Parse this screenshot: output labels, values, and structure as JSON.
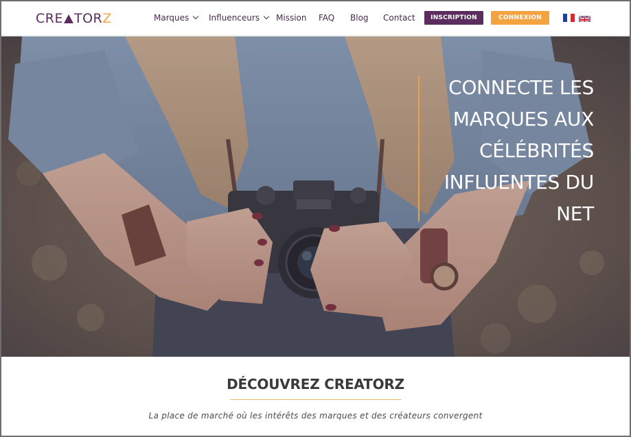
{
  "header": {
    "logo_prefix": "CRE",
    "logo_middle": "TOR",
    "logo_suffix": "Z",
    "nav": [
      {
        "label": "Marques",
        "has_dropdown": true
      },
      {
        "label": "Influenceurs",
        "has_dropdown": true
      },
      {
        "label": "Mission",
        "has_dropdown": false
      },
      {
        "label": "FAQ",
        "has_dropdown": false
      },
      {
        "label": "Blog",
        "has_dropdown": false
      },
      {
        "label": "Contact",
        "has_dropdown": false
      }
    ],
    "inscription_label": "INSCRIPTION",
    "connexion_label": "CONNEXION",
    "languages": [
      "french-flag-icon",
      "uk-flag-icon"
    ]
  },
  "hero": {
    "headline_lines": [
      "CONNECTE LES",
      "MARQUES AUX",
      "CÉLÉBRITÉS",
      "INFLUENTES DU",
      "NET"
    ]
  },
  "intro": {
    "title": "DÉCOUVREZ CREATORZ",
    "tagline": "La place de marché où les intérêts des marques et des créateurs convergent"
  },
  "colors": {
    "brand_purple": "#5b2d5f",
    "brand_orange": "#f4a341",
    "accent_gold": "#e8a24a"
  }
}
